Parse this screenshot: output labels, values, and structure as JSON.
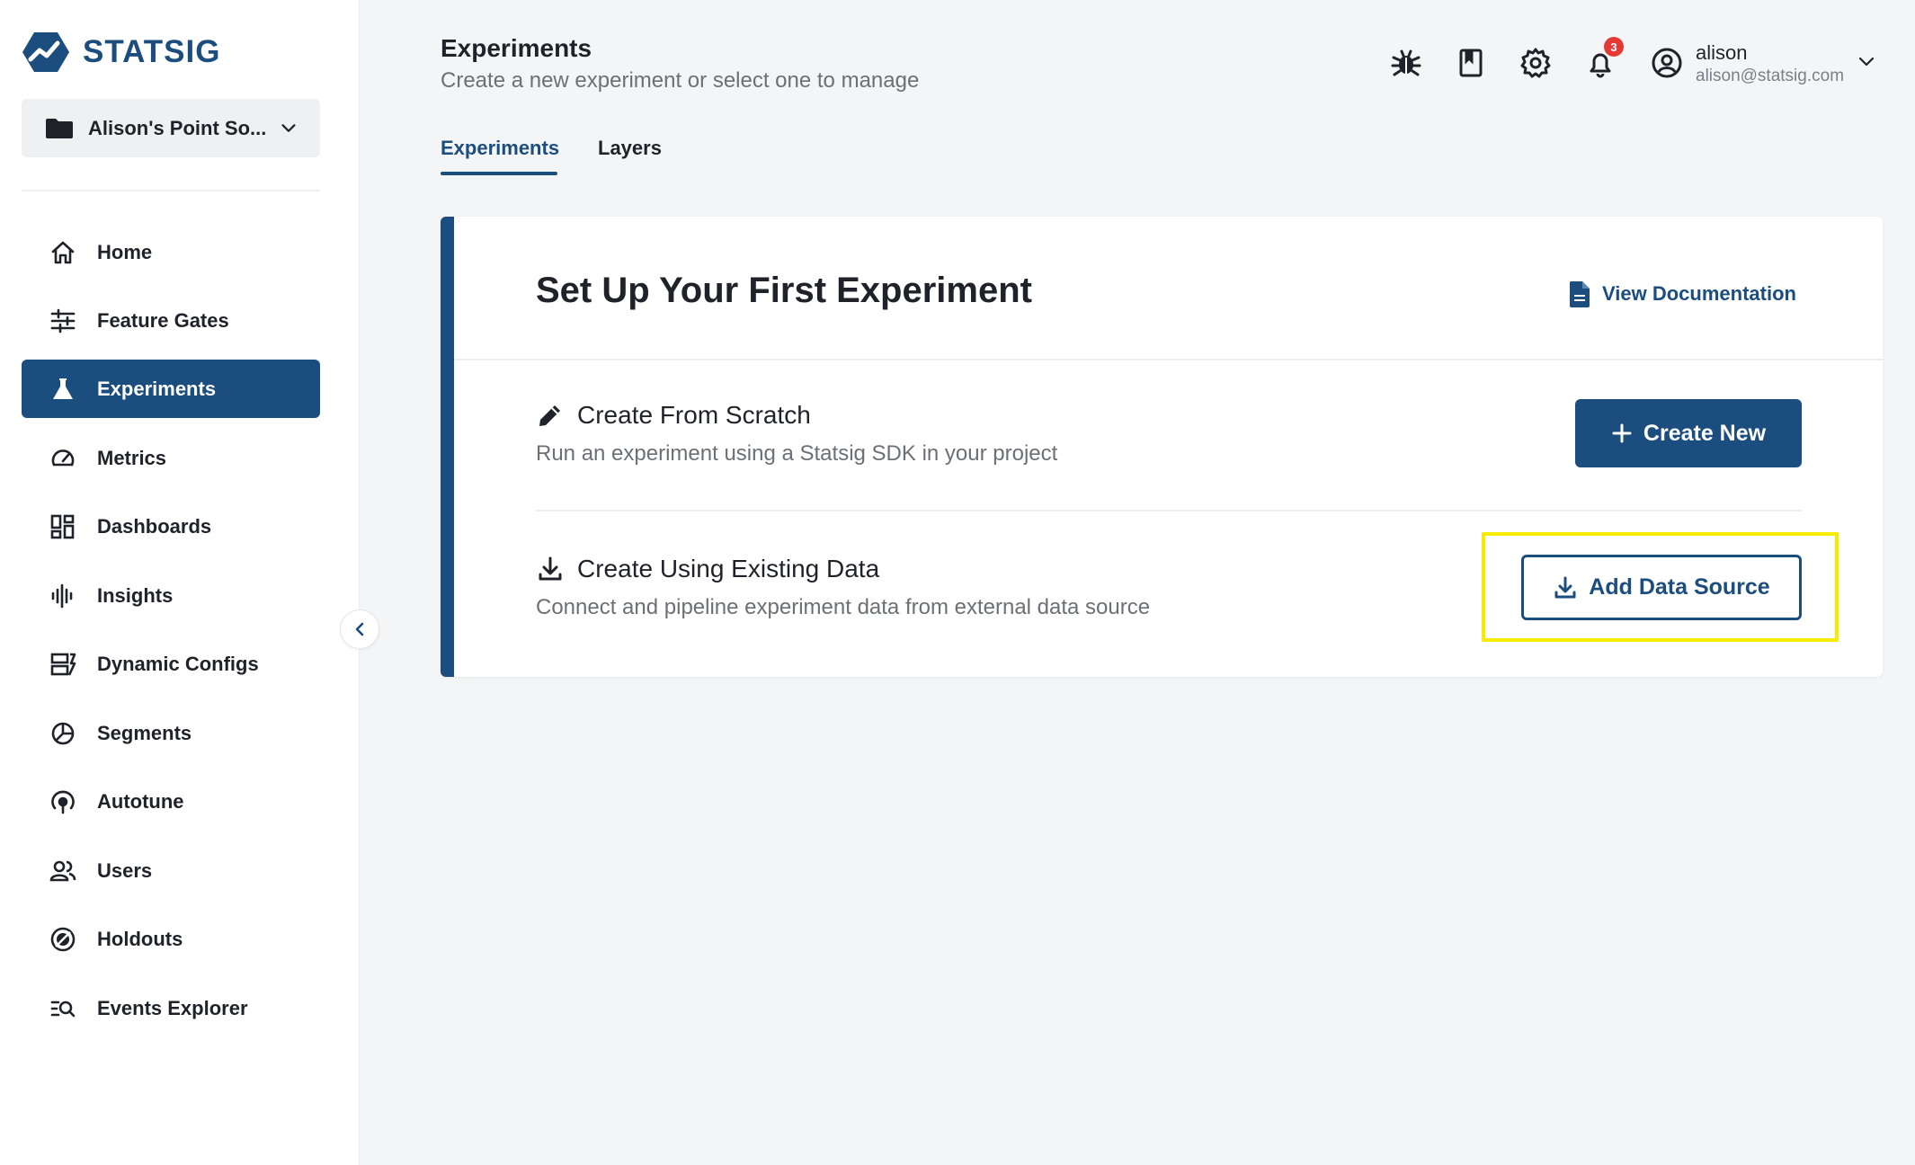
{
  "brand": {
    "name": "STATSIG",
    "color": "#1b4d7e"
  },
  "project": {
    "name": "Alison's Point So..."
  },
  "sidebar": {
    "items": [
      {
        "label": "Home",
        "icon": "home-icon"
      },
      {
        "label": "Feature Gates",
        "icon": "sliders-icon"
      },
      {
        "label": "Experiments",
        "icon": "flask-icon",
        "active": true
      },
      {
        "label": "Metrics",
        "icon": "gauge-icon"
      },
      {
        "label": "Dashboards",
        "icon": "dashboard-grid-icon"
      },
      {
        "label": "Insights",
        "icon": "waveform-icon"
      },
      {
        "label": "Dynamic Configs",
        "icon": "config-icon"
      },
      {
        "label": "Segments",
        "icon": "segments-icon"
      },
      {
        "label": "Autotune",
        "icon": "autotune-icon"
      },
      {
        "label": "Users",
        "icon": "users-icon"
      },
      {
        "label": "Holdouts",
        "icon": "holdouts-icon"
      },
      {
        "label": "Events Explorer",
        "icon": "events-search-icon"
      }
    ]
  },
  "header": {
    "title": "Experiments",
    "subtitle": "Create a new experiment or select one to manage",
    "notifications_count": "3",
    "user": {
      "name": "alison",
      "email": "alison@statsig.com"
    }
  },
  "tabs": [
    {
      "label": "Experiments",
      "active": true
    },
    {
      "label": "Layers",
      "active": false
    }
  ],
  "card": {
    "title": "Set Up Your First Experiment",
    "doc_link": "View Documentation",
    "scratch": {
      "title": "Create From Scratch",
      "description": "Run an experiment using a Statsig SDK in your project",
      "button": "Create New"
    },
    "existing": {
      "title": "Create Using Existing Data",
      "description": "Connect and pipeline experiment data from external data source",
      "button": "Add Data Source"
    }
  },
  "colors": {
    "primary": "#1b4d7e",
    "highlight": "#f5ec00",
    "badge": "#e53935"
  }
}
